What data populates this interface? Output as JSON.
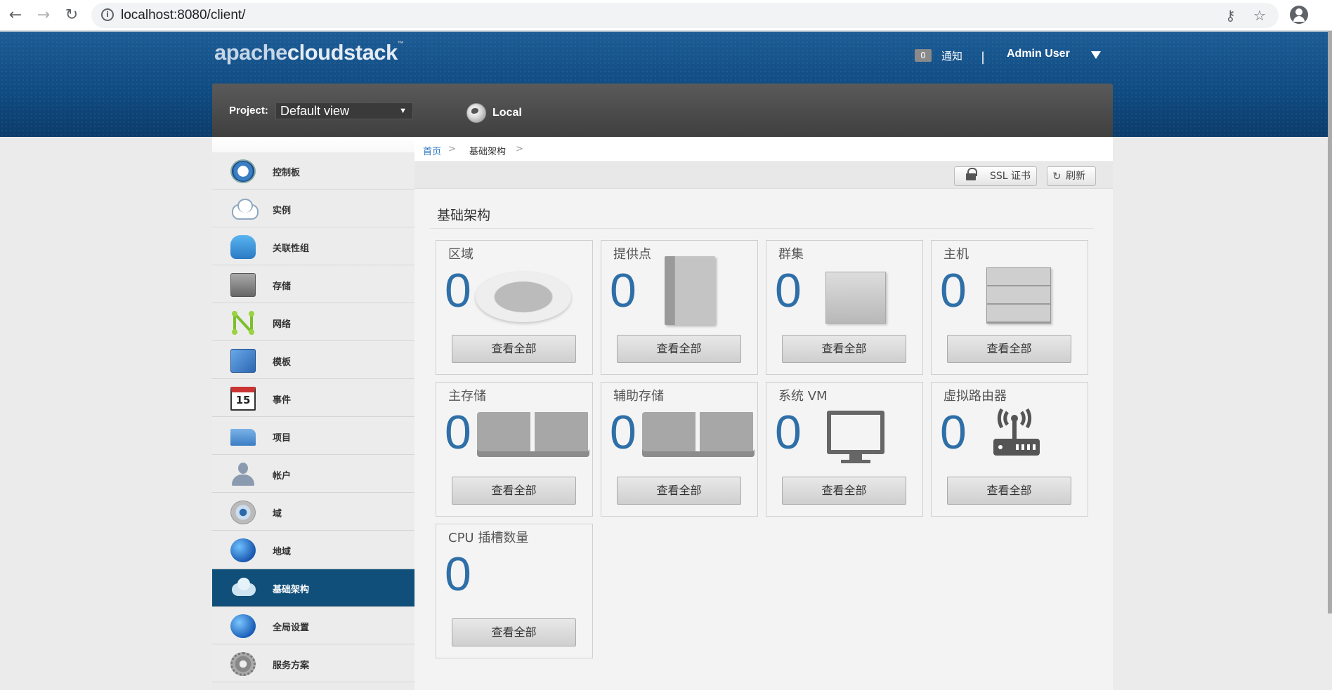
{
  "browser": {
    "url": "localhost:8080/client/",
    "back_icon": "arrow-left",
    "forward_icon": "arrow-right",
    "reload_icon": "reload",
    "info_icon": "info-circle",
    "key_icon": "key",
    "star_icon": "star",
    "profile_icon": "account-circle"
  },
  "header": {
    "logo_part1": "apache",
    "logo_part2": "cloudstack",
    "logo_tm": "™",
    "notification_count": "0",
    "notification_label": "通知",
    "separator": "|",
    "user_name": "Admin User"
  },
  "project_bar": {
    "project_label": "Project:",
    "project_value": "Default view",
    "zone_label": "Local"
  },
  "sidebar": {
    "items": [
      {
        "label": "控制板",
        "icon": "dashboard-icon"
      },
      {
        "label": "实例",
        "icon": "cloud-icon"
      },
      {
        "label": "关联性组",
        "icon": "affinity-icon"
      },
      {
        "label": "存储",
        "icon": "storage-icon"
      },
      {
        "label": "网络",
        "icon": "network-icon"
      },
      {
        "label": "模板",
        "icon": "template-icon"
      },
      {
        "label": "事件",
        "icon": "calendar-icon",
        "icon_text": "15"
      },
      {
        "label": "项目",
        "icon": "folder-icon"
      },
      {
        "label": "帐户",
        "icon": "user-icon"
      },
      {
        "label": "域",
        "icon": "domain-icon"
      },
      {
        "label": "地域",
        "icon": "globe-icon"
      },
      {
        "label": "基础架构",
        "icon": "infrastructure-icon",
        "active": true
      },
      {
        "label": "全局设置",
        "icon": "global-settings-icon"
      },
      {
        "label": "服务方案",
        "icon": "gear-icon"
      }
    ]
  },
  "breadcrumb": {
    "home": "首页",
    "sep": ">",
    "current": "基础架构"
  },
  "toolbar": {
    "ssl_label": "SSL 证书",
    "refresh_label": "刷新"
  },
  "main": {
    "title": "基础架构",
    "view_all_label": "查看全部",
    "cards": [
      {
        "title": "区域",
        "count": "0"
      },
      {
        "title": "提供点",
        "count": "0"
      },
      {
        "title": "群集",
        "count": "0"
      },
      {
        "title": "主机",
        "count": "0"
      },
      {
        "title": "主存储",
        "count": "0"
      },
      {
        "title": "辅助存储",
        "count": "0"
      },
      {
        "title": "系统 VM",
        "count": "0"
      },
      {
        "title": "虚拟路由器",
        "count": "0"
      },
      {
        "title": "CPU 插槽数量",
        "count": "0"
      }
    ]
  }
}
